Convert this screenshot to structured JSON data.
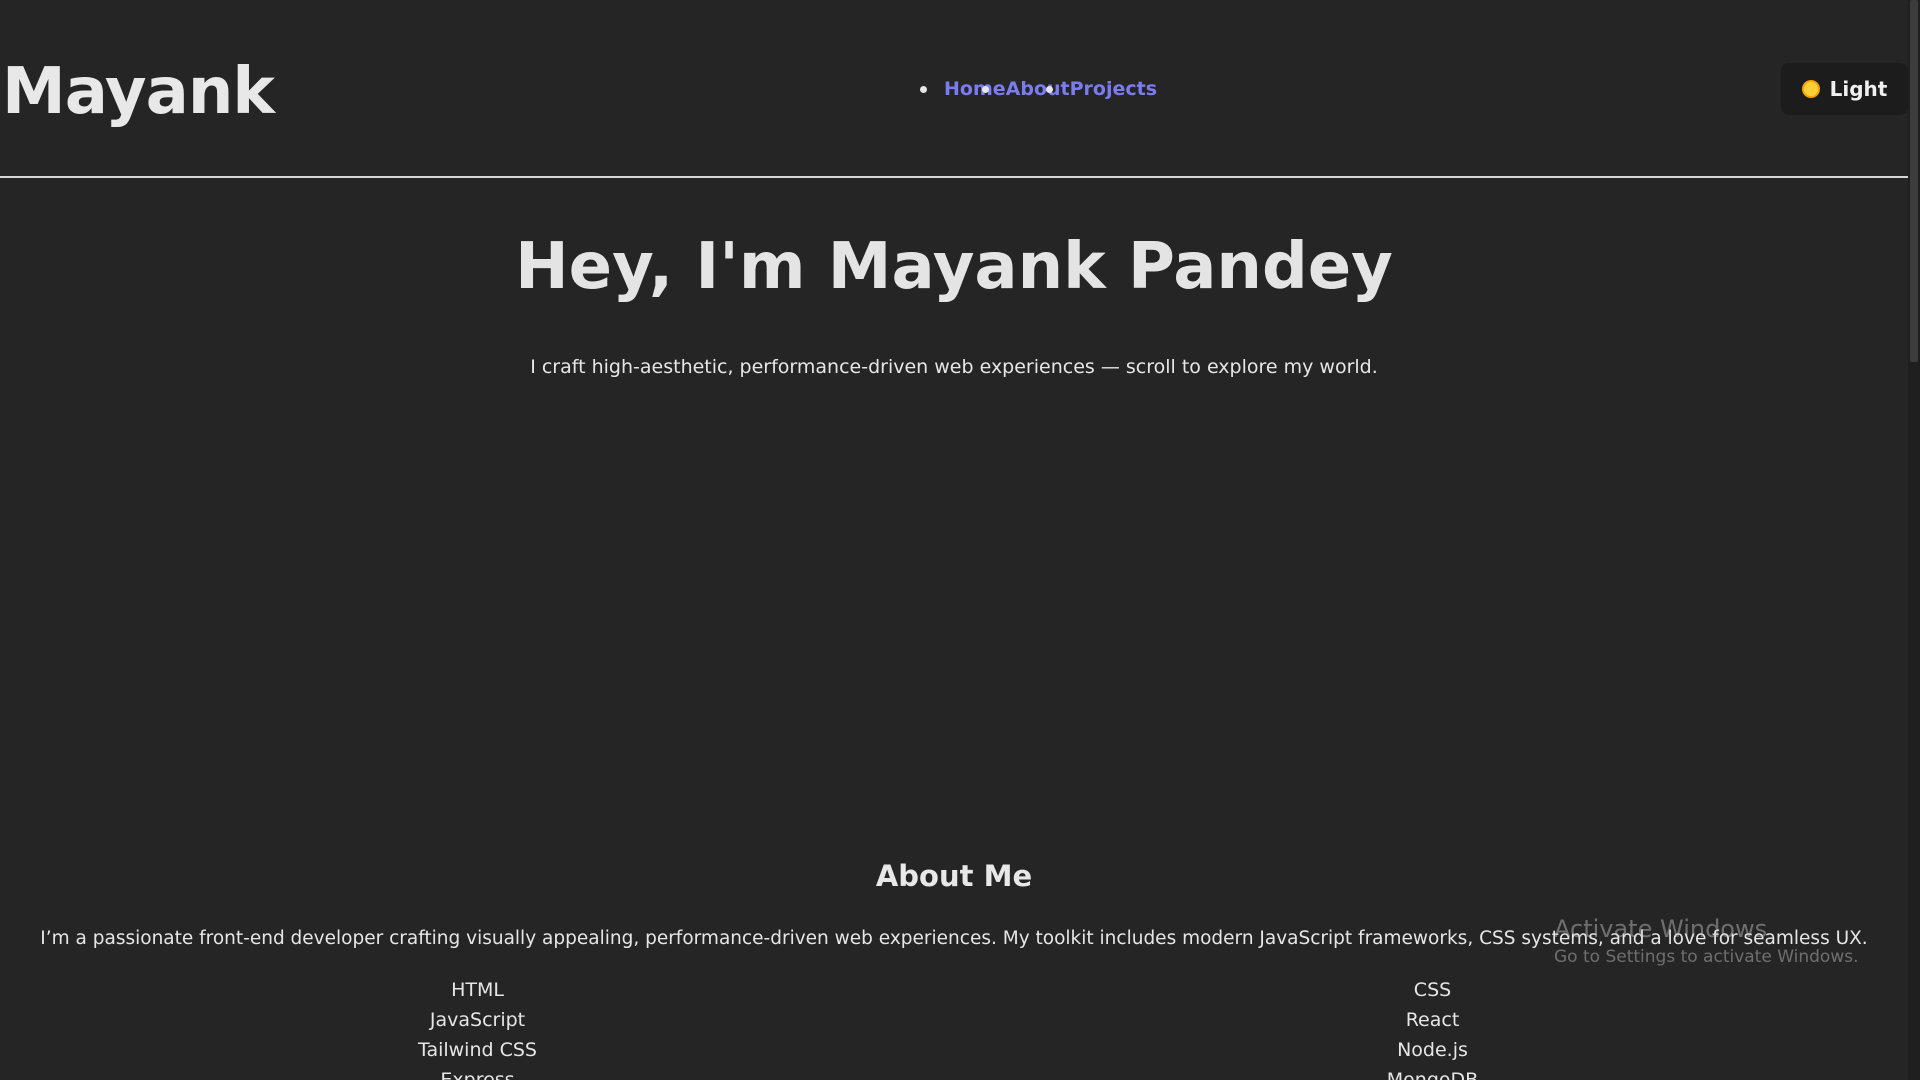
{
  "header": {
    "logo": "Mayank",
    "nav": [
      {
        "label": "Home"
      },
      {
        "label": "About"
      },
      {
        "label": "Projects"
      }
    ],
    "theme_toggle": {
      "icon": "sun-icon",
      "label": "Light"
    }
  },
  "hero": {
    "title": "Hey, I'm Mayank Pandey",
    "subtitle": "I craft high-aesthetic, performance-driven web experiences — scroll to explore my world."
  },
  "about": {
    "title": "About Me",
    "text": "I’m a passionate front-end developer crafting visually appealing, performance-driven web experiences. My toolkit includes modern JavaScript frameworks, CSS systems, and a love for seamless UX.",
    "skills": [
      "HTML",
      "CSS",
      "JavaScript",
      "React",
      "Tailwind CSS",
      "Node.js",
      "Express",
      "MongoDB"
    ]
  },
  "watermark": {
    "title": "Activate Windows",
    "subtitle": "Go to Settings to activate Windows."
  },
  "colors": {
    "background": "#252525",
    "link": "#7b7cf0",
    "text": "#e6e6e6",
    "button_bg": "#1c1c1c"
  }
}
